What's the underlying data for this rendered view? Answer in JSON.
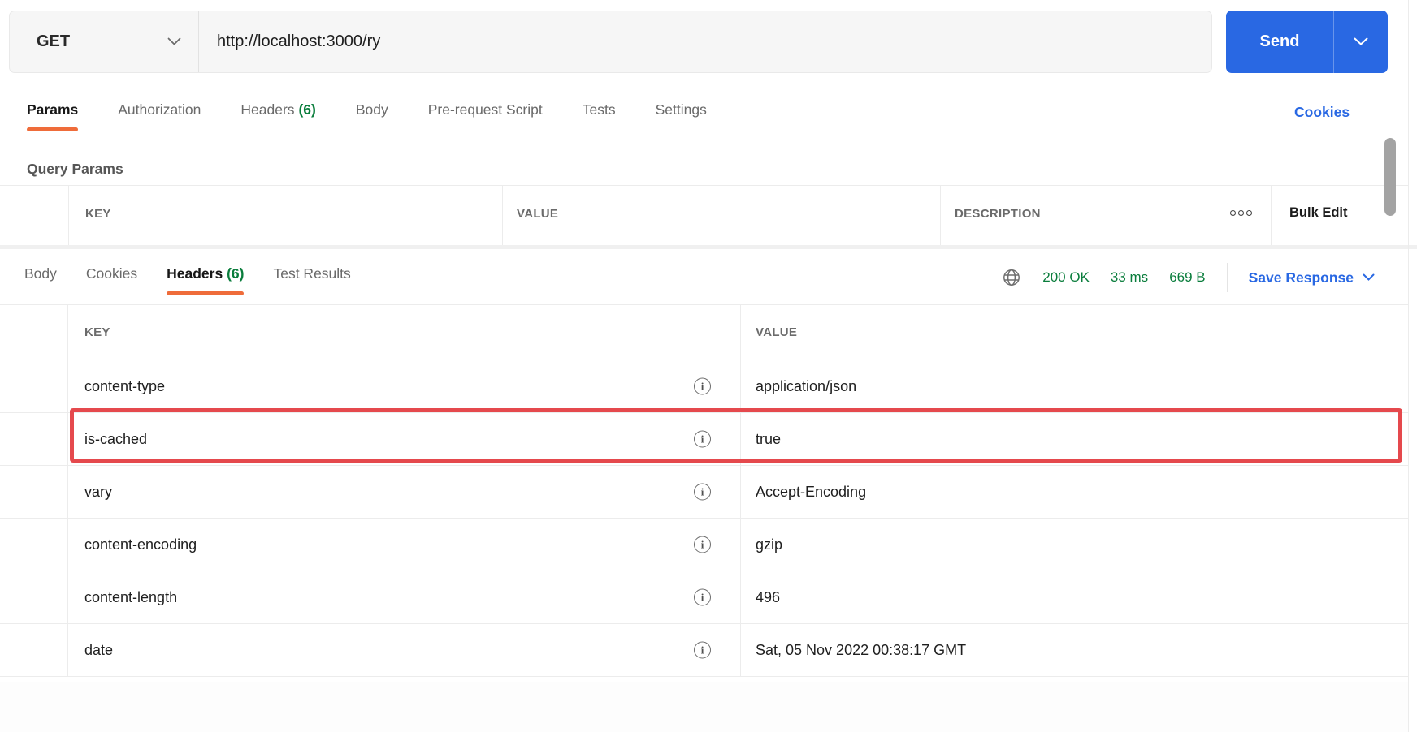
{
  "colors": {
    "orange": "#ef6c3a",
    "green": "#0a7d3c",
    "blue": "#2968e3",
    "red": "#e5494d"
  },
  "request_bar": {
    "method": "GET",
    "url": "http://localhost:3000/ry",
    "send_label": "Send"
  },
  "request_tabs": {
    "params": "Params",
    "authorization": "Authorization",
    "headers": "Headers",
    "headers_count": "(6)",
    "body": "Body",
    "pre_request": "Pre-request Script",
    "tests": "Tests",
    "settings": "Settings",
    "cookies_link": "Cookies"
  },
  "query_params": {
    "title": "Query Params",
    "col_key": "KEY",
    "col_value": "VALUE",
    "col_description": "DESCRIPTION",
    "bulk_edit": "Bulk Edit"
  },
  "response": {
    "tabs": {
      "body": "Body",
      "cookies": "Cookies",
      "headers": "Headers",
      "headers_count": "(6)",
      "test_results": "Test Results"
    },
    "status": {
      "code": "200 OK",
      "time": "33 ms",
      "size": "669 B"
    },
    "save_label": "Save Response",
    "table": {
      "col_key": "KEY",
      "col_value": "VALUE",
      "rows": [
        {
          "key": "content-type",
          "value": "application/json",
          "highlighted": false
        },
        {
          "key": "is-cached",
          "value": "true",
          "highlighted": true
        },
        {
          "key": "vary",
          "value": "Accept-Encoding",
          "highlighted": false
        },
        {
          "key": "content-encoding",
          "value": "gzip",
          "highlighted": false
        },
        {
          "key": "content-length",
          "value": "496",
          "highlighted": false
        },
        {
          "key": "date",
          "value": "Sat, 05 Nov 2022 00:38:17 GMT",
          "highlighted": false
        }
      ]
    }
  }
}
